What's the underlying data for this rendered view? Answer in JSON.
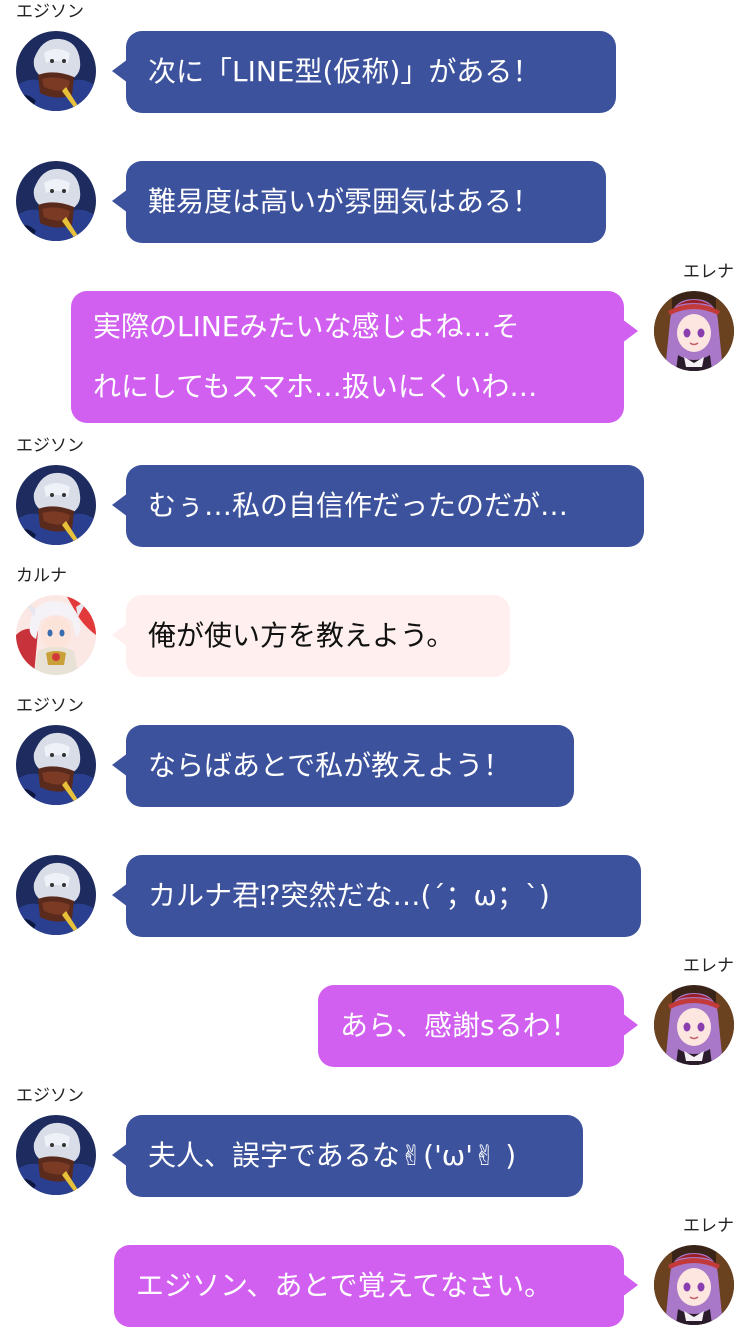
{
  "characters": {
    "edison": {
      "name": "エジソン",
      "bubble_color": "#3d529c",
      "avatar_icon": "lion-avatar-icon"
    },
    "elena": {
      "name": "エレナ",
      "bubble_color": "#d15ff0",
      "avatar_icon": "girl-avatar-icon"
    },
    "karna": {
      "name": "カルナ",
      "bubble_color": "#fff0ef",
      "avatar_icon": "white-hair-avatar-icon"
    }
  },
  "messages": [
    {
      "speaker": "edison",
      "show_name": true,
      "lines": [
        "次に「LINE型(仮称)」がある！"
      ]
    },
    {
      "speaker": "edison",
      "show_name": false,
      "lines": [
        "難易度は高いが雰囲気はある！"
      ]
    },
    {
      "speaker": "elena",
      "show_name": true,
      "lines": [
        "実際のLINEみたいな感じよね…そ",
        "れにしてもスマホ…扱いにくいわ…"
      ]
    },
    {
      "speaker": "edison",
      "show_name": true,
      "lines": [
        "むぅ…私の自信作だったのだが…"
      ]
    },
    {
      "speaker": "karna",
      "show_name": true,
      "lines": [
        "俺が使い方を教えよう。"
      ]
    },
    {
      "speaker": "edison",
      "show_name": true,
      "lines": [
        "ならばあとで私が教えよう！"
      ]
    },
    {
      "speaker": "edison",
      "show_name": false,
      "lines": [
        "カルナ君⁉突然だな…(´；ω；`)"
      ]
    },
    {
      "speaker": "elena",
      "show_name": true,
      "lines": [
        "あら、感謝sるわ！"
      ]
    },
    {
      "speaker": "edison",
      "show_name": true,
      "lines": [
        "夫人、誤字であるな✌('ω'✌ )"
      ]
    },
    {
      "speaker": "elena",
      "show_name": true,
      "lines": [
        "エジソン、あとで覚えてなさい。"
      ]
    }
  ]
}
